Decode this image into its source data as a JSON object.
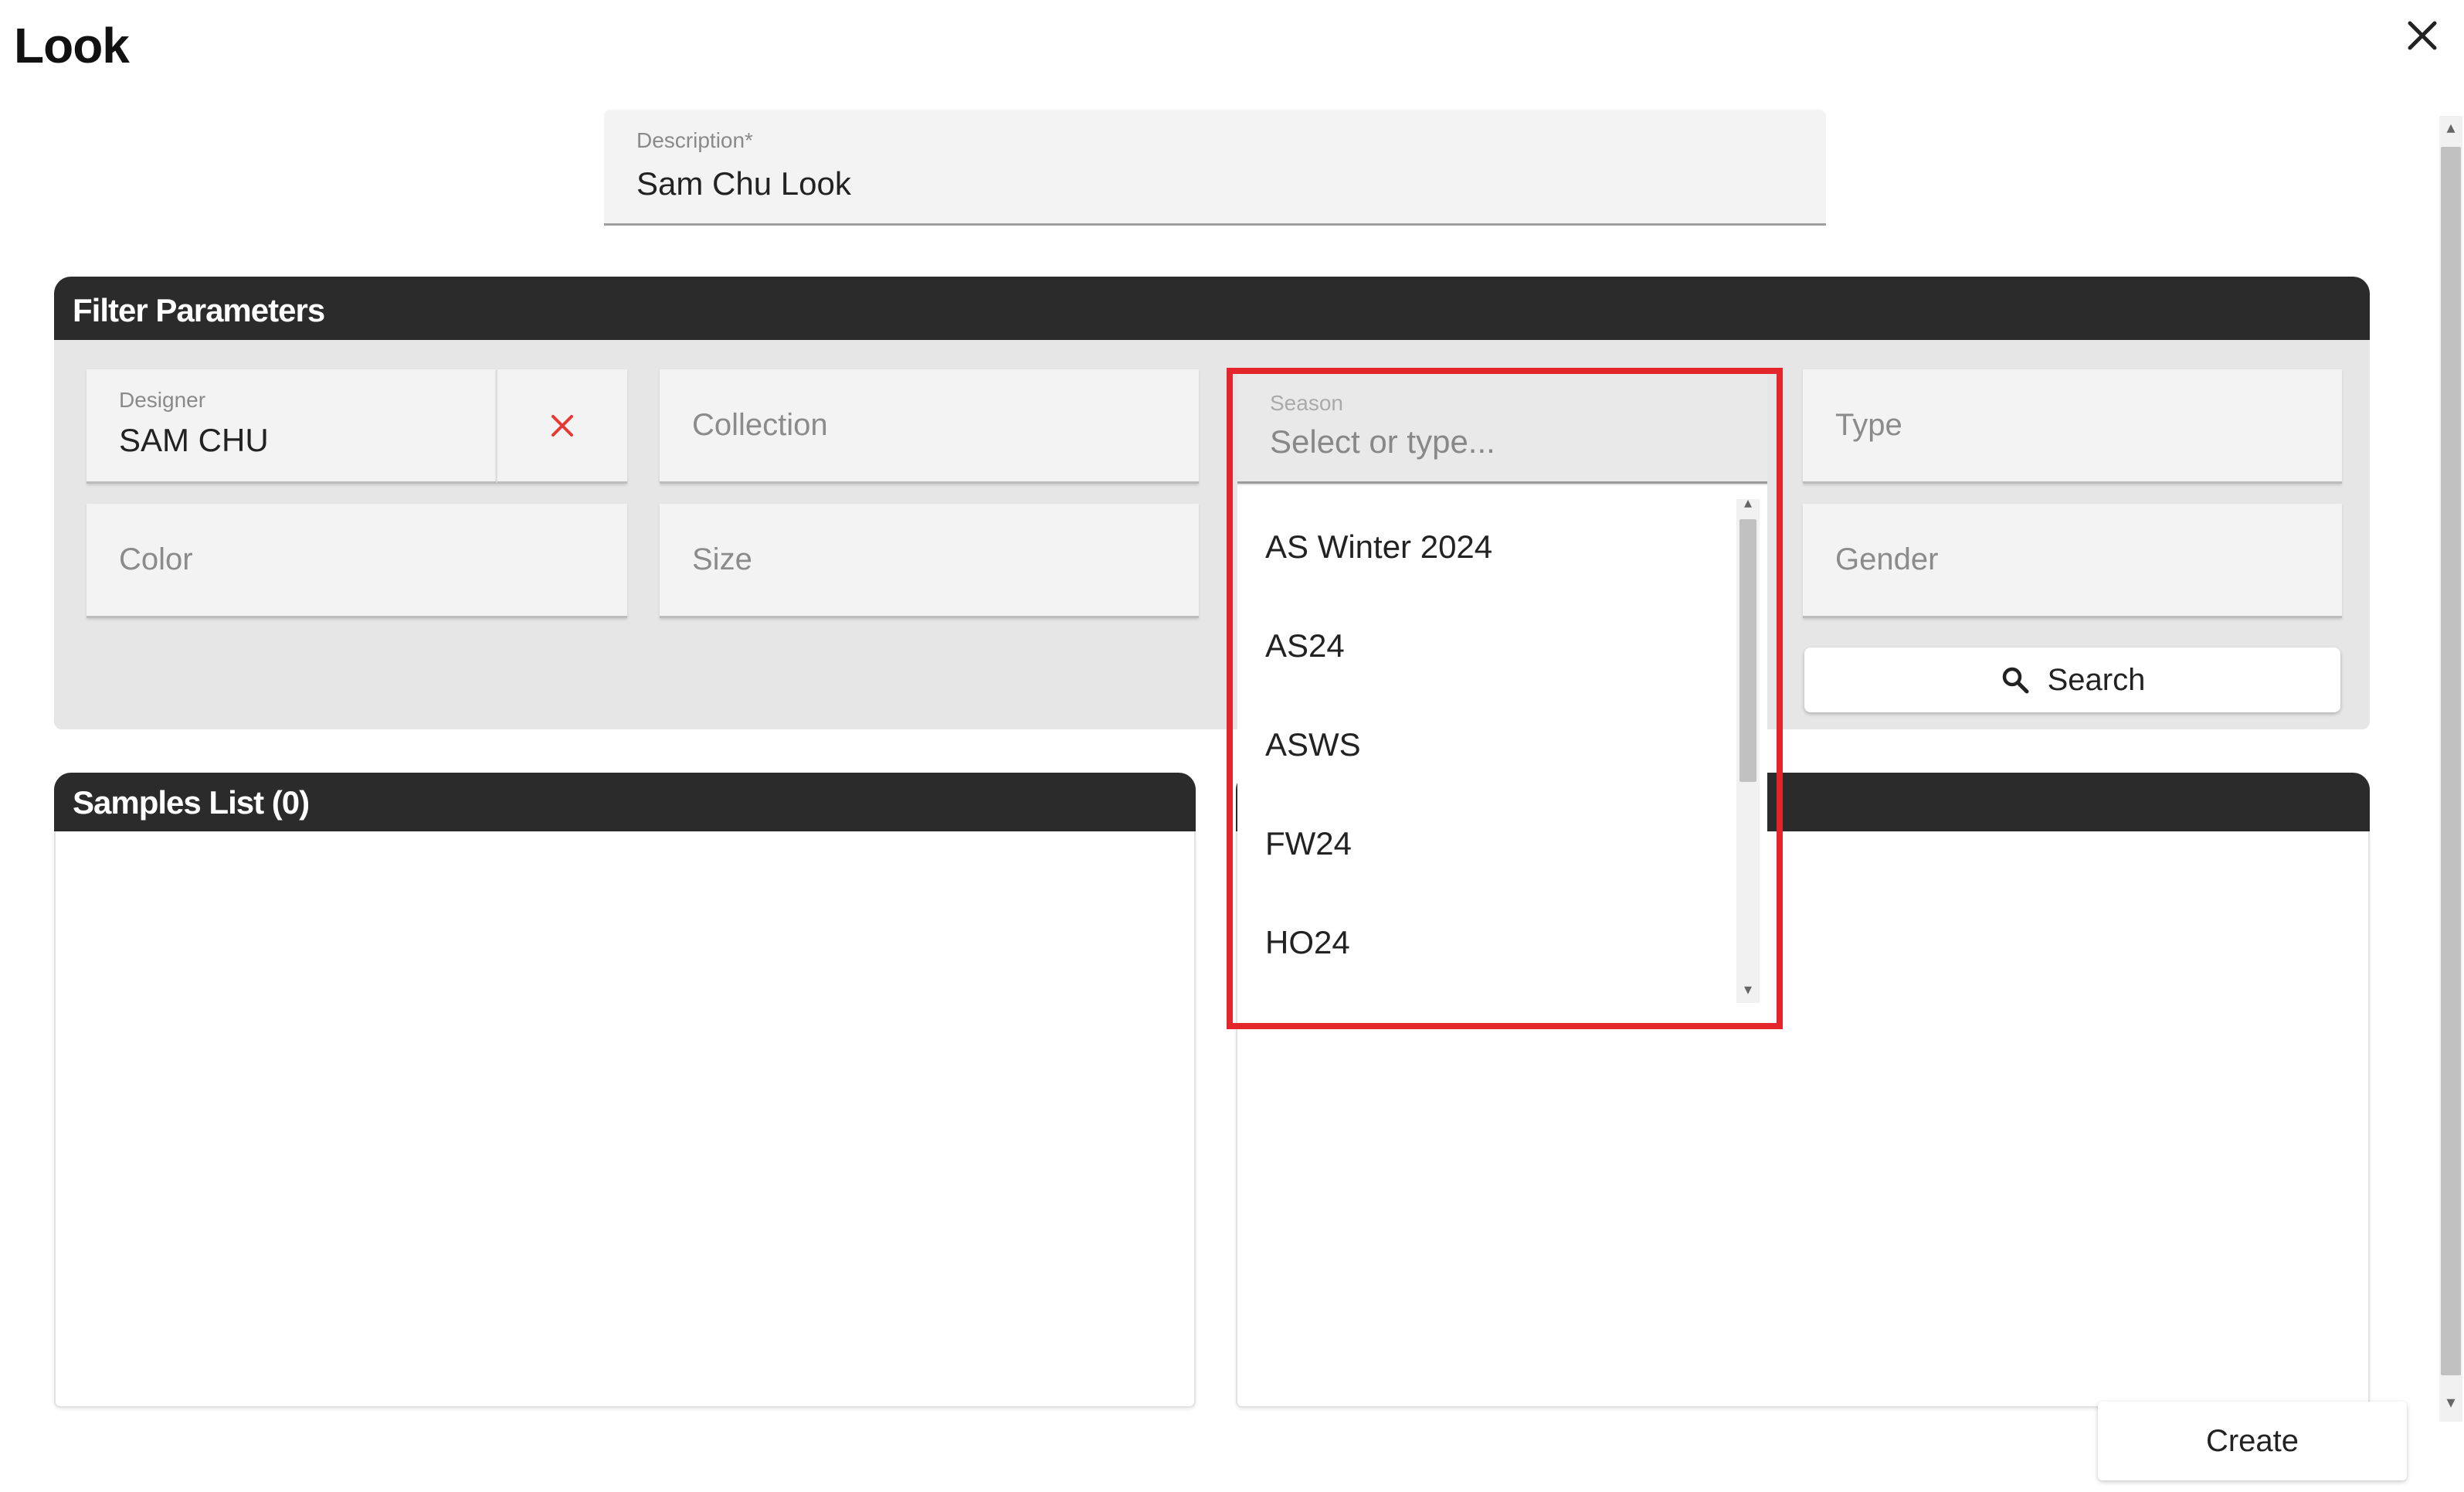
{
  "dialog": {
    "title": "Look"
  },
  "description": {
    "label": "Description*",
    "value": "Sam Chu Look"
  },
  "filter": {
    "heading": "Filter Parameters",
    "designer": {
      "label": "Designer",
      "value": "SAM CHU"
    },
    "collection_placeholder": "Collection",
    "season": {
      "label": "Season",
      "placeholder": "Select or type...",
      "options": [
        "AS Winter 2024",
        "AS24",
        "ASWS",
        "FW24",
        "HO24"
      ]
    },
    "type_placeholder": "Type",
    "color_placeholder": "Color",
    "size_placeholder": "Size",
    "gender_placeholder": "Gender",
    "search_label": "Search"
  },
  "samples": {
    "heading": "Samples List (0)"
  },
  "footer": {
    "create_label": "Create"
  },
  "colors": {
    "highlight": "#e4262c",
    "header_bg": "#2b2b2b",
    "clear_icon": "#e53935"
  },
  "icons": {
    "close": "close-icon",
    "clear": "clear-x-icon",
    "search": "search-icon"
  }
}
